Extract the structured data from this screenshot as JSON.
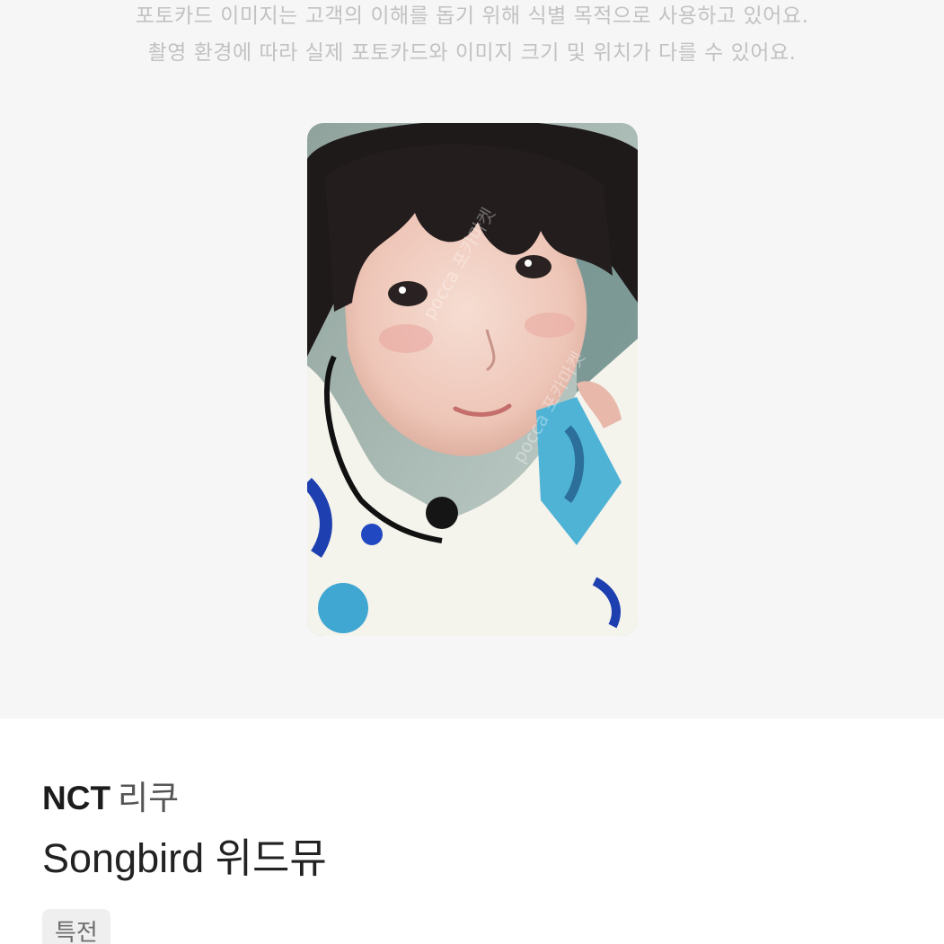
{
  "notice": {
    "line1": "포토카드 이미지는 고객의 이해를 돕기 위해 식별 목적으로 사용하고 있어요.",
    "line2": "촬영 환경에 따라 실제 포토카드와 이미지 크기 및 위치가 다를 수 있어요."
  },
  "product": {
    "group": "NCT",
    "member": "리쿠",
    "album": "Songbird 위드뮤",
    "tag": "특전"
  },
  "photocard": {
    "image_icon": "photocard-image",
    "watermark": "pocca 포카마켓"
  }
}
